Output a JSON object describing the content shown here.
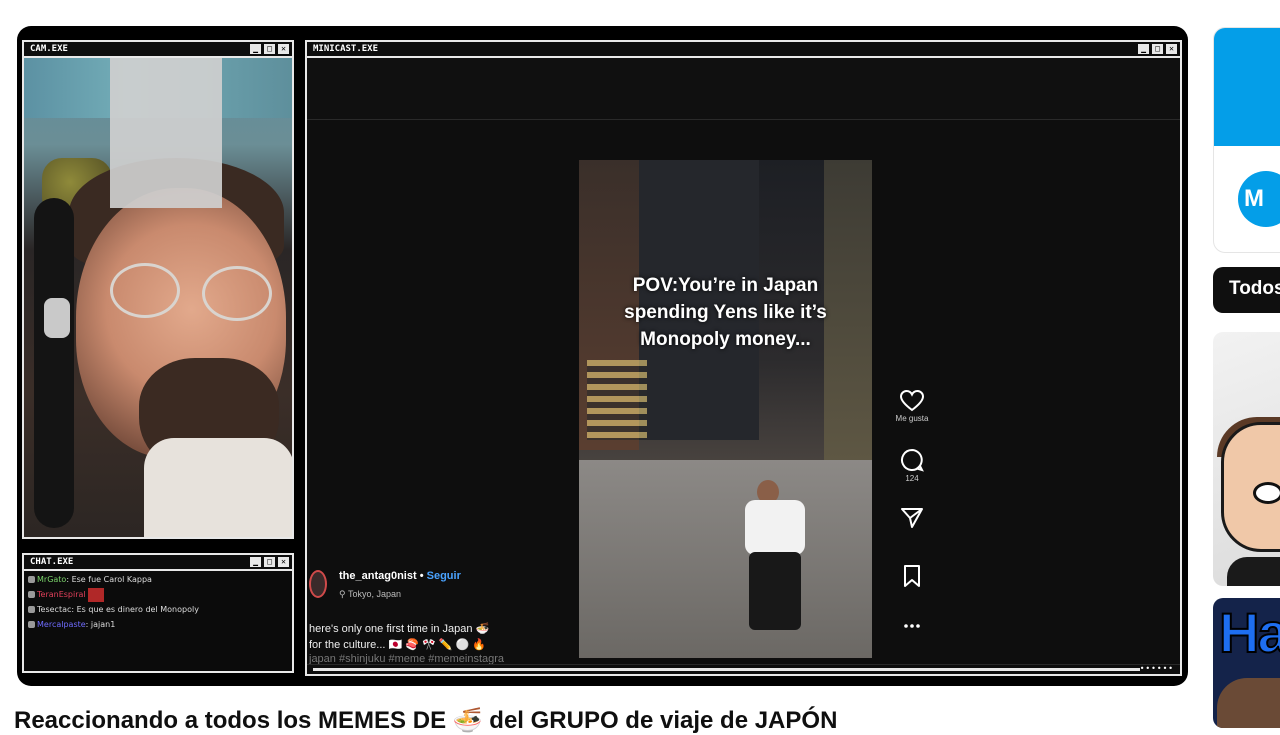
{
  "cam_window": {
    "title": "CAM.EXE"
  },
  "minicast_window": {
    "title": "MINICAST.EXE"
  },
  "chat_window": {
    "title": "CHAT.EXE",
    "messages": [
      {
        "user": "MrGato",
        "text": "Ese fue Carol Kappa",
        "user_color": "#7ad36a"
      },
      {
        "user": "TeranEspiral",
        "text": "",
        "user_color": "#e0405a"
      },
      {
        "user": "Tesectac",
        "text": "Es que es dinero del Monopoly",
        "user_color": "#d8d8d8"
      },
      {
        "user": "Mercalpaste",
        "text": "jajan1",
        "user_color": "#6f6cff"
      }
    ]
  },
  "window_controls": {
    "minimize": "▁",
    "maximize": "□",
    "close": "✕"
  },
  "video": {
    "caption_lines": [
      "POV:You’re in Japan",
      "spending Yens like it’s",
      "Monopoly money..."
    ],
    "like_label": "Me gusta",
    "comment_count": "124",
    "author": "the_antag0nist",
    "follow_label": "Seguir",
    "location": "Tokyo, Japan",
    "description": "here's only one first time in Japan 🍜",
    "description_2": "for the culture... 🇯🇵 🍣 🎌 ✏️ ⚪ 🔥",
    "hashtags": "japan #shinjuku #meme #memeinstagra",
    "progress_dots": "••••••"
  },
  "video_title": "Reaccionando a todos los MEMES DE 🍜 del GRUPO de viaje de JAPÓN",
  "sidebar": {
    "ad_logo": "M",
    "chip_label": "Todos",
    "thumb2_text": "Ha"
  }
}
